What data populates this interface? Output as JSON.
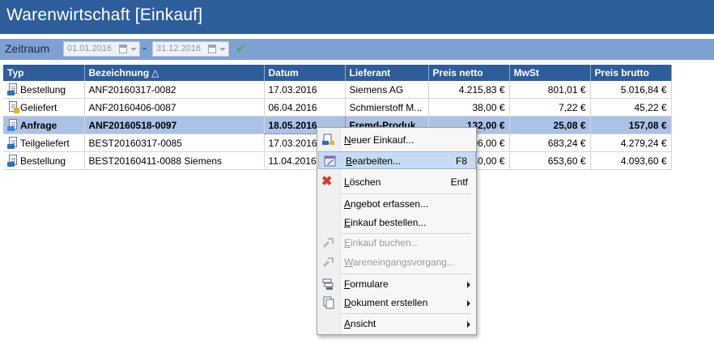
{
  "window": {
    "title": "Warenwirtschaft [Einkauf]"
  },
  "filter": {
    "label": "Zeitraum",
    "date_from": "01.01.2016",
    "separator": "-",
    "date_to": "31.12.2016",
    "apply_icon": "checkmark-icon"
  },
  "table": {
    "columns": [
      "Typ",
      "Bezeichnung",
      "Datum",
      "Lieferant",
      "Preis netto",
      "MwSt",
      "Preis brutto"
    ],
    "sort_indicator": "△",
    "rows": [
      {
        "typ": "Bestellung",
        "bezeichnung": "ANF20160317-0082",
        "datum": "17.03.2016",
        "lieferant": "Siemens AG",
        "netto": "4.215,83 €",
        "mwst": "801,01 €",
        "brutto": "5.016,84 €"
      },
      {
        "typ": "Geliefert",
        "bezeichnung": "ANF20160406-0087",
        "datum": "06.04.2016",
        "lieferant": "Schmierstoff M...",
        "netto": "38,00 €",
        "mwst": "7,22 €",
        "brutto": "45,22 €"
      },
      {
        "typ": "Anfrage",
        "bezeichnung": "ANF20160518-0097",
        "datum": "18.05.2016",
        "lieferant": "Fremd-Produk...",
        "netto": "132,00 €",
        "mwst": "25,08 €",
        "brutto": "157,08 €"
      },
      {
        "typ": "Teilgeliefert",
        "bezeichnung": "BEST20160317-0085",
        "datum": "17.03.2016",
        "lieferant": "",
        "netto": "96,00 €",
        "mwst": "683,24 €",
        "brutto": "4.279,24 €"
      },
      {
        "typ": "Bestellung",
        "bezeichnung": "BEST20160411-0088 Siemens",
        "datum": "11.04.2016",
        "lieferant": "",
        "netto": "40,00 €",
        "mwst": "653,60 €",
        "brutto": "4.093,60 €"
      }
    ],
    "selected_row": 2
  },
  "context_menu": {
    "items": [
      {
        "label_u": "N",
        "label_rest": "euer Einkauf...",
        "shortcut": "",
        "icon": "new-purchase-icon",
        "enabled": true
      },
      {
        "label_u": "B",
        "label_rest": "earbeiten...",
        "shortcut": "F8",
        "icon": "edit-icon",
        "enabled": true
      },
      {
        "label_u": "L",
        "label_rest": "öschen",
        "shortcut": "Entf",
        "icon": "delete-icon",
        "enabled": true
      },
      {
        "label_u": "A",
        "label_rest": "ngebot erfassen...",
        "shortcut": "",
        "icon": "",
        "enabled": true
      },
      {
        "label_u": "E",
        "label_rest": "inkauf bestellen...",
        "shortcut": "",
        "icon": "",
        "enabled": true
      },
      {
        "label_u": "E",
        "label_rest": "inkauf buchen...",
        "shortcut": "",
        "icon": "book-icon",
        "enabled": false
      },
      {
        "label_u": "W",
        "label_rest": "areneingangsvorgang...",
        "shortcut": "",
        "icon": "goods-receipt-icon",
        "enabled": false
      },
      {
        "label_u": "F",
        "label_rest": "ormulare",
        "shortcut": "",
        "icon": "forms-icon",
        "enabled": true,
        "submenu": true
      },
      {
        "label_u": "D",
        "label_rest": "okument erstellen",
        "shortcut": "",
        "icon": "document-icon",
        "enabled": true,
        "submenu": true
      },
      {
        "label_u": "A",
        "label_rest": "nsicht",
        "shortcut": "",
        "icon": "",
        "enabled": true,
        "submenu": true
      }
    ],
    "highlighted_index": 1
  },
  "colors": {
    "header_blue": "#2e5d9c",
    "filter_bar": "#7fa1d2",
    "selected_row": "#aac2e6",
    "menu_highlight": "#c7dcf3"
  }
}
